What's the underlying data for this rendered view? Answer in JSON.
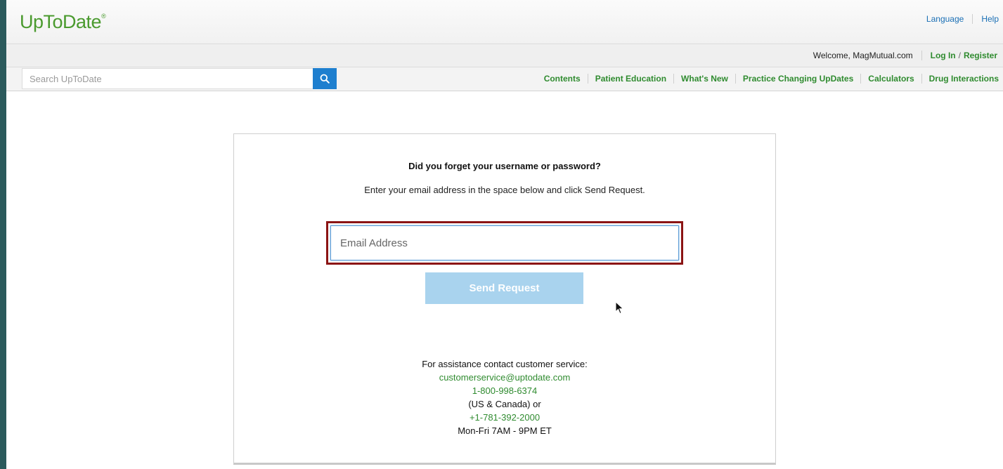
{
  "header": {
    "logo": "UpToDate",
    "logo_mark": "®",
    "links": [
      "Language",
      "Help"
    ]
  },
  "userbar": {
    "welcome": "Welcome,",
    "user": "MagMutual.com",
    "login": "Log In",
    "slash": "/",
    "register": "Register"
  },
  "search": {
    "placeholder": "Search UpToDate",
    "icon": "search-icon"
  },
  "nav": {
    "items": [
      "Contents",
      "Patient Education",
      "What's New",
      "Practice Changing UpDates",
      "Calculators",
      "Drug Interactions"
    ]
  },
  "form": {
    "title": "Did you forget your username or password?",
    "subtitle": "Enter your email address in the space below and click Send Request.",
    "email_placeholder": "Email Address",
    "send_label": "Send Request"
  },
  "assistance": {
    "intro": "For assistance contact customer service:",
    "email": "customerservice@uptodate.com",
    "phone_us": "1-800-998-6374",
    "region_note": "(US & Canada) or",
    "phone_intl": "+1-781-392-2000",
    "hours": "Mon-Fri 7AM - 9PM ET"
  },
  "colors": {
    "brand_green": "#4a9a2e",
    "link_green": "#2f8b2f",
    "link_blue": "#1a6fb5",
    "search_button": "#1e7fcf",
    "send_button": "#a9d3ee",
    "highlight_border": "#8b1414"
  }
}
